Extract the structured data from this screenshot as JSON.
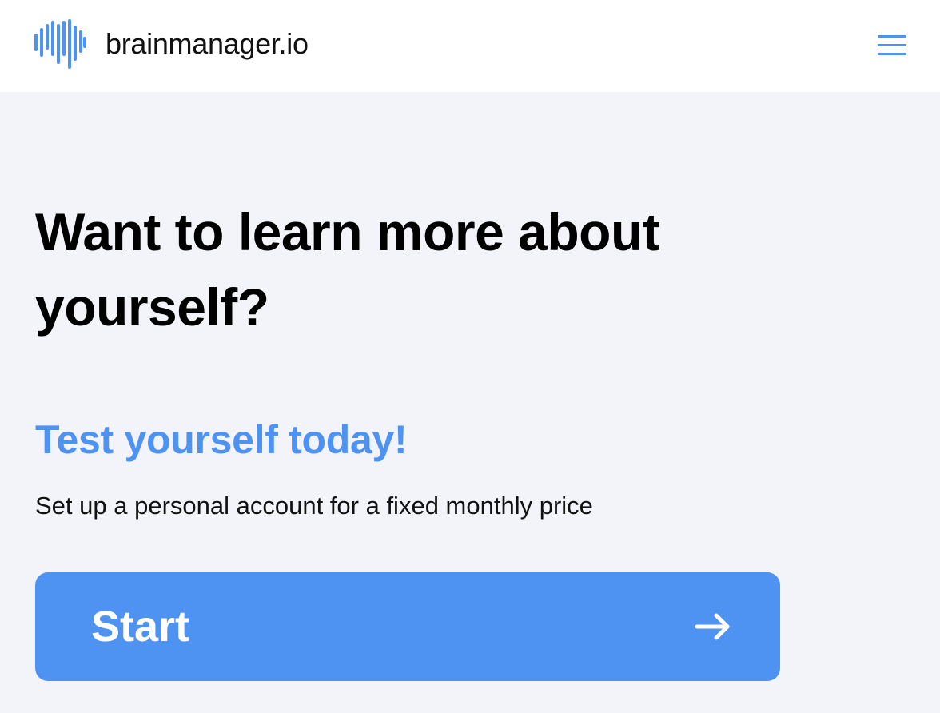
{
  "header": {
    "brand": "brainmanager.io",
    "logo_icon": "soundwave-icon",
    "menu_icon": "hamburger-menu-icon"
  },
  "hero": {
    "headline": "Want to learn more about yourself?",
    "subheadline": "Test yourself today!",
    "description": "Set up a personal account for a fixed monthly price",
    "cta_label": "Start",
    "cta_icon": "arrow-right-icon"
  },
  "colors": {
    "accent": "#4e93f2",
    "background": "#f3f4f9",
    "header_background": "#ffffff",
    "text": "#000000"
  }
}
